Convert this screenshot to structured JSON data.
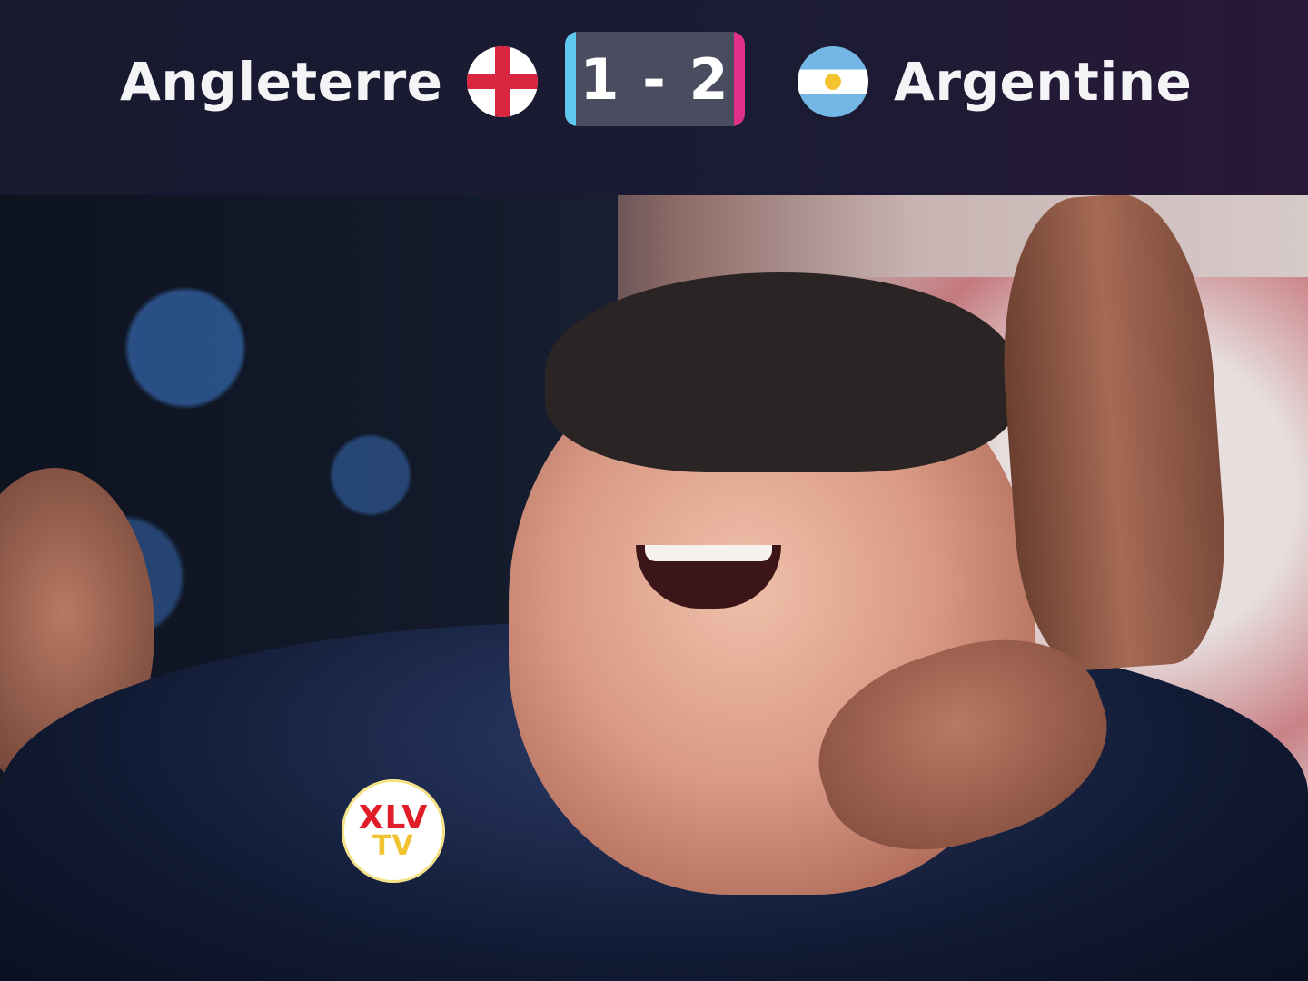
{
  "scoreboard": {
    "home_team": "Angleterre",
    "away_team": "Argentine",
    "score": "1 - 2",
    "home_flag_icon": "england-flag-icon",
    "away_flag_icon": "argentina-flag-icon",
    "accent_left": "#5fc8ef",
    "accent_right": "#e0308a"
  },
  "watermark": {
    "line1": "XLV",
    "line2": "TV"
  }
}
